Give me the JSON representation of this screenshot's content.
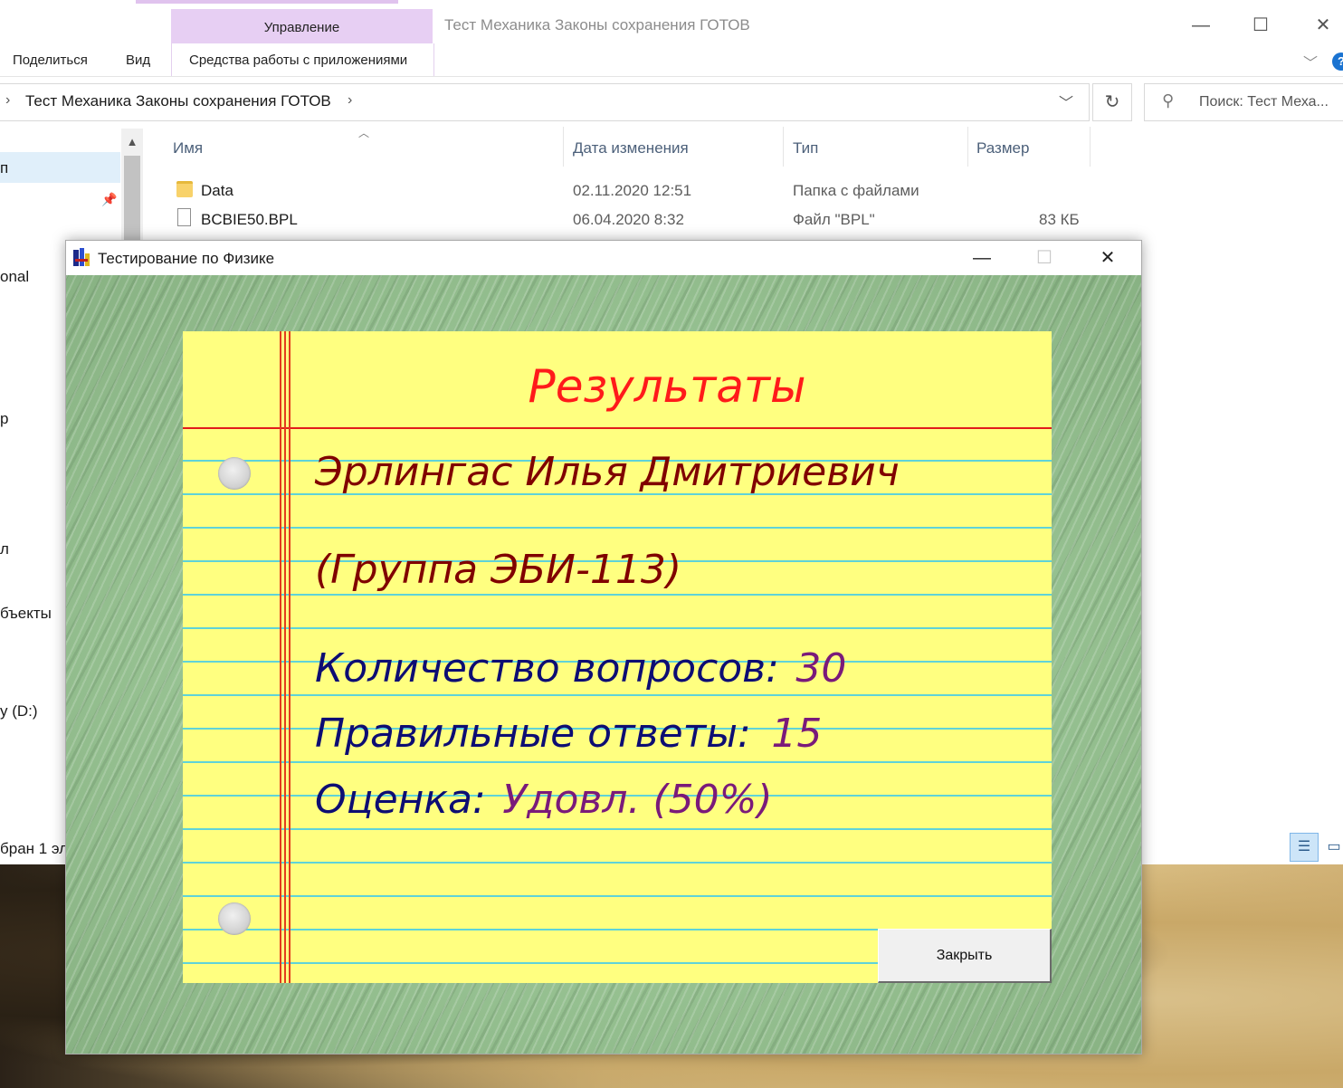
{
  "explorer": {
    "title": "Тест Механика Законы сохранения ГОТОВ",
    "ribbon": {
      "manage_label": "Управление",
      "tabs": [
        "Поделиться",
        "Вид",
        "Средства работы с приложениями"
      ]
    },
    "address_path": "Тест Механика Законы сохранения ГОТОВ",
    "search_placeholder": "Поиск: Тест Меха...",
    "nav_items": [
      "п",
      "onal",
      "р",
      "л",
      "бъекты",
      "y (D:)"
    ],
    "columns": [
      "Имя",
      "Дата изменения",
      "Тип",
      "Размер"
    ],
    "files": [
      {
        "name": "Data",
        "modified": "02.11.2020 12:51",
        "type": "Папка с файлами",
        "size": "",
        "icon": "folder-icon"
      },
      {
        "name": "BCBIE50.BPL",
        "modified": "06.04.2020 8:32",
        "type": "Файл \"BPL\"",
        "size": "83 КБ",
        "icon": "file-icon"
      }
    ],
    "status": "бран 1 эл"
  },
  "dialog": {
    "title": "Тестирование по Физике",
    "results_title": "Результаты",
    "student_name": "Эрлингас Илья Дмитриевич",
    "group": "(Группа ЭБИ-113)",
    "questions_label": "Количество вопросов:",
    "questions_value": "30",
    "correct_label": "Правильные ответы:",
    "correct_value": "15",
    "grade_label": "Оценка:",
    "grade_value": "Удовл. (50%)",
    "close_button": "Закрыть"
  },
  "colors": {
    "results_title": "#ff1a1a",
    "student_text": "#800000",
    "stat_label": "#0d0d73",
    "stat_value": "#7a1a7a",
    "paper": "#ffff80",
    "background_green": "#97c292"
  }
}
